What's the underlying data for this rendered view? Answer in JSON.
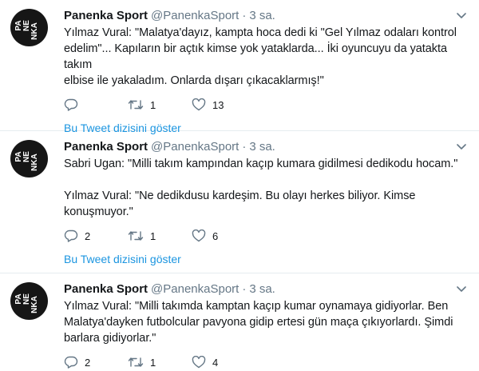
{
  "tweets": [
    {
      "author_name": "Panenka Sport",
      "handle": "@PanenkaSport",
      "separator": "·",
      "time": "3 sa.",
      "text": "Yılmaz Vural: \"Malatya'dayız, kampta hoca dedi ki \"Gel Yılmaz odaları kontrol\nedelim\"... Kapıların bir açtık kimse yok yataklarda... İki oyuncuyu da yatakta takım\nelbise ile yakaladım. Onlarda dışarı çıkacaklarmış!\"",
      "replies": "",
      "retweets": "1",
      "likes": "13",
      "thread_link": "Bu Tweet dizisini göster"
    },
    {
      "author_name": "Panenka Sport",
      "handle": "@PanenkaSport",
      "separator": "·",
      "time": "3 sa.",
      "text": "Sabri Ugan: \"Milli takım kampından kaçıp kumara gidilmesi dedikodu hocam.\"\n\nYılmaz Vural: \"Ne dedikdusu kardeşim. Bu olayı herkes biliyor. Kimse\nkonuşmuyor.\"",
      "replies": "2",
      "retweets": "1",
      "likes": "6",
      "thread_link": "Bu Tweet dizisini göster"
    },
    {
      "author_name": "Panenka Sport",
      "handle": "@PanenkaSport",
      "separator": "·",
      "time": "3 sa.",
      "text": "Yılmaz Vural: \"Milli takımda kamptan kaçıp kumar oynamaya gidiyorlar. Ben\nMalatya'dayken futbolcular pavyona gidip ertesi gün maça çıkıyorlardı. Şimdi\nbarlara gidiyorlar.\"",
      "replies": "2",
      "retweets": "1",
      "likes": "4",
      "thread_link": ""
    }
  ],
  "avatar": {
    "logo_text": "PANENKA",
    "bg_color": "#161616",
    "fg_color": "#ffffff"
  },
  "colors": {
    "link": "#1b95e0",
    "meta": "#657786",
    "text": "#14171a",
    "divider": "#e6ecf0"
  },
  "icons": {
    "reply": "reply-icon",
    "retweet": "retweet-icon",
    "like": "heart-icon",
    "caret": "chevron-down-icon"
  }
}
